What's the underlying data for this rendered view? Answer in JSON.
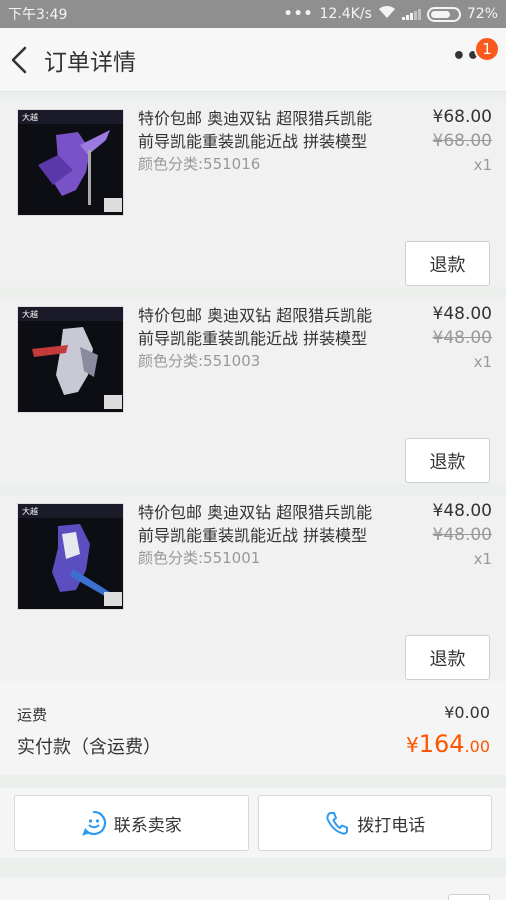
{
  "status_bar": {
    "time": "下午3:49",
    "dots": "•••",
    "speed": "12.4K/s",
    "battery": "72%"
  },
  "header": {
    "title": "订单详情",
    "more_badge": "1"
  },
  "items": [
    {
      "name": "特价包邮 奥迪双钻 超限猎兵凯能前导凯能重装凯能近战 拼装模型",
      "sku": "颜色分类:551016",
      "price": "¥68.00",
      "original_price": "¥68.00",
      "qty": "x1",
      "refund_label": "退款",
      "thumb_color": "#7a52c8"
    },
    {
      "name": "特价包邮 奥迪双钻 超限猎兵凯能前导凯能重装凯能近战 拼装模型",
      "sku": "颜色分类:551003",
      "price": "¥48.00",
      "original_price": "¥48.00",
      "qty": "x1",
      "refund_label": "退款",
      "thumb_color": "#c9c9d6"
    },
    {
      "name": "特价包邮 奥迪双钻 超限猎兵凯能前导凯能重装凯能近战 拼装模型",
      "sku": "颜色分类:551001",
      "price": "¥48.00",
      "original_price": "¥48.00",
      "qty": "x1",
      "refund_label": "退款",
      "thumb_color": "#5a4ec0"
    }
  ],
  "totals": {
    "shipping_label": "运费",
    "shipping_value": "¥0.00",
    "paid_label": "实付款（含运费）",
    "paid_symbol": "¥",
    "paid_int": "164",
    "paid_dec": ".00"
  },
  "contact": {
    "seller_label": "联系卖家",
    "phone_label": "拨打电话"
  },
  "colors": {
    "accent": "#ff5500",
    "badge": "#fb5a1d",
    "icon_blue": "#2f9bf0"
  },
  "icons": [
    "back-chevron-icon",
    "more-icon",
    "wifi-icon",
    "signal-icon",
    "battery-icon",
    "chat-smile-icon",
    "phone-icon"
  ]
}
